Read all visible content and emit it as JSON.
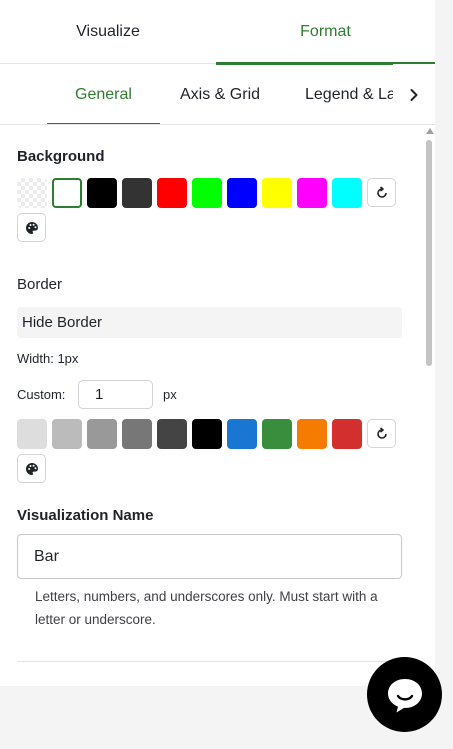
{
  "top_tabs": [
    {
      "label": "Visualize",
      "active": false
    },
    {
      "label": "Format",
      "active": true
    }
  ],
  "sub_tabs": [
    {
      "label": "General",
      "active": true
    },
    {
      "label": "Axis & Grid",
      "active": false
    },
    {
      "label": "Legend & Labels",
      "active": false
    }
  ],
  "sub_tabs_scroll_icon": "chevron-right-icon",
  "accent_color": "#2e7d32",
  "background": {
    "title": "Background",
    "swatches": [
      "transparent",
      "#ffffff",
      "#000000",
      "#333333",
      "#ff0000",
      "#00ff00",
      "#0000ff",
      "#ffff00",
      "#ff00ff",
      "#00ffff"
    ],
    "selected": "#ffffff",
    "reset_icon": "reset-icon",
    "picker_icon": "palette-icon"
  },
  "border": {
    "title": "Border",
    "toggle_label": "Hide Border",
    "width_label": "Width: 1px",
    "custom_label": "Custom:",
    "custom_value": "1",
    "unit": "px",
    "swatches": [
      "#dddddd",
      "#bbbbbb",
      "#999999",
      "#777777",
      "#444444",
      "#000000",
      "#1976d2",
      "#388e3c",
      "#f57c00",
      "#d32f2f"
    ],
    "reset_icon": "reset-icon",
    "picker_icon": "palette-icon"
  },
  "visualization_name": {
    "title": "Visualization Name",
    "value": "Bar",
    "helper": "Letters, numbers, and underscores only. Must start with a letter or underscore."
  },
  "chat_icon": "chat-bubble-icon"
}
